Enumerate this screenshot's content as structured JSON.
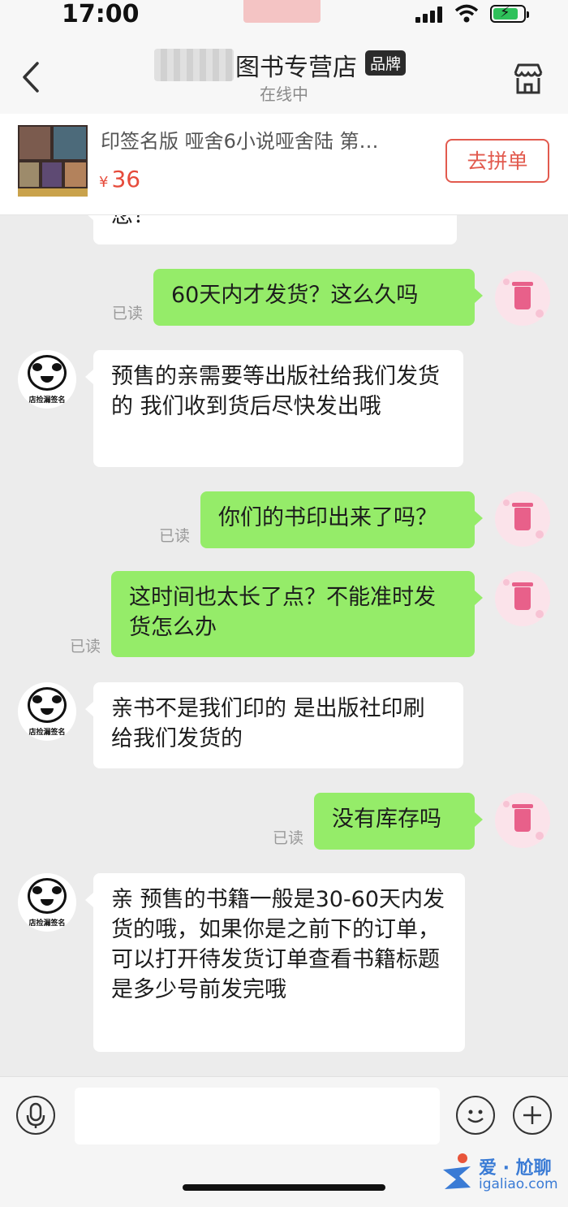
{
  "status": {
    "time": "17:00"
  },
  "header": {
    "shop_name": "图书专营店",
    "badge": "品牌",
    "status": "在线中"
  },
  "product": {
    "title": "印签名版 哑舍6小说哑舍陆 第…",
    "price_symbol": "¥",
    "price": "36",
    "action": "去拼单"
  },
  "read_label": "已读",
  "messages": [
    {
      "from": "shop",
      "text": "您？"
    },
    {
      "from": "me",
      "text": "60天内才发货？这么久吗"
    },
    {
      "from": "shop",
      "text": "预售的亲需要等出版社给我们发货的 我们收到货后尽快发出哦"
    },
    {
      "from": "me",
      "text": "你们的书印出来了吗？"
    },
    {
      "from": "me",
      "text": "这时间也太长了点？不能准时发货怎么办"
    },
    {
      "from": "shop",
      "text": "亲书不是我们印的 是出版社印刷给我们发货的"
    },
    {
      "from": "me",
      "text": "没有库存吗"
    },
    {
      "from": "shop",
      "text": "亲 预售的书籍一般是30-60天内发货的哦，如果你是之前下的订单，可以打开待发货订单查看书籍标题是多少号前发完哦"
    }
  ],
  "avatar_caption": "店捡漏签名",
  "input": {
    "placeholder": ""
  },
  "watermark": {
    "cn": "爱 · 尬聊",
    "en": "igaliao.com"
  },
  "colors": {
    "outgoing": "#95ec69",
    "incoming": "#ffffff",
    "price": "#e64b3b",
    "chat_bg": "#ececec"
  }
}
